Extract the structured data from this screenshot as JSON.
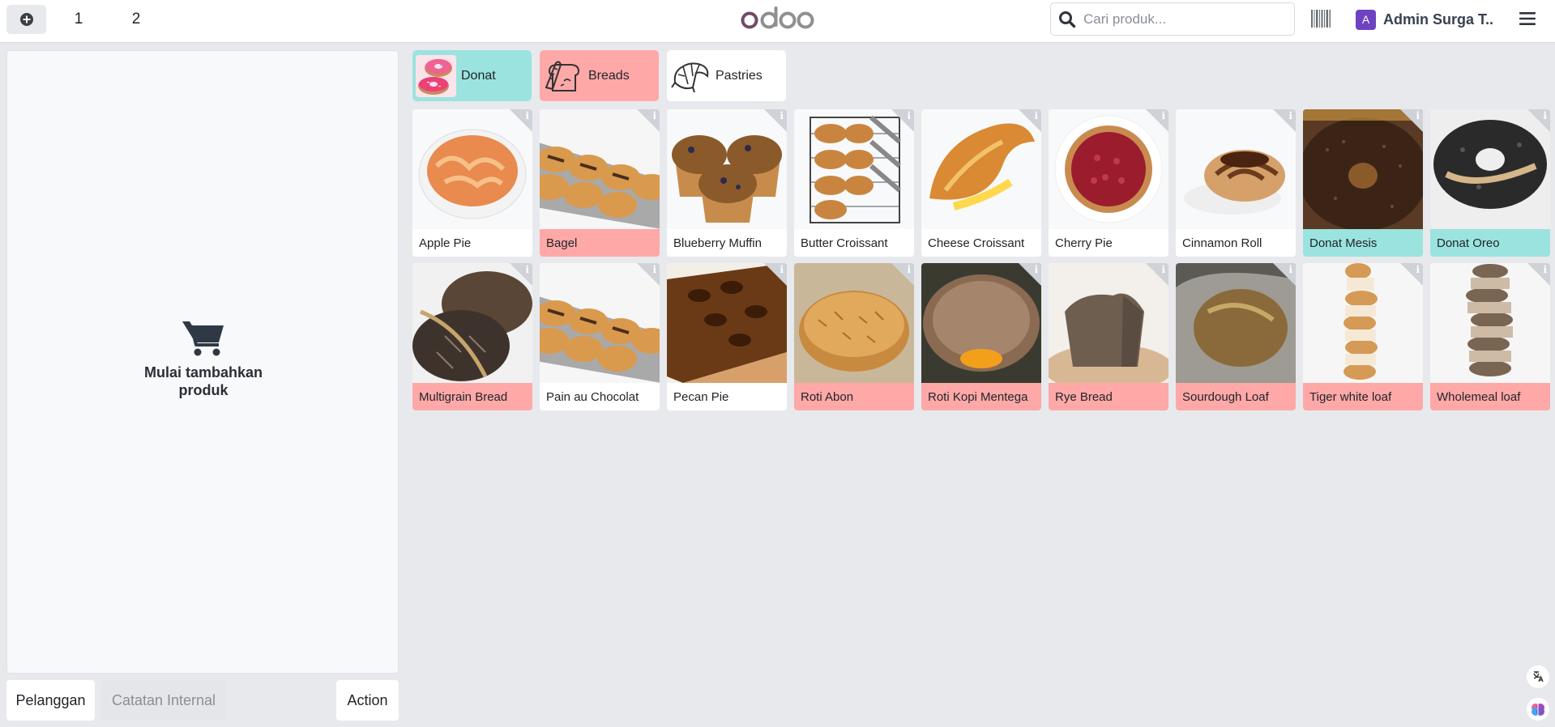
{
  "topbar": {
    "order_tabs": [
      "1",
      "2"
    ],
    "logo_text": "odoo",
    "search_placeholder": "Cari produk...",
    "user_initial": "A",
    "user_name": "Admin Surga T..."
  },
  "order": {
    "empty_message": "Mulai tambahkan produk"
  },
  "actions": {
    "customer": "Pelanggan",
    "internal_note": "Catatan Internal",
    "action": "Action"
  },
  "categories": [
    {
      "label": "Donat",
      "color": "#9be3de",
      "icon": "donut-icon"
    },
    {
      "label": "Breads",
      "color": "#ffa8a8",
      "icon": "bread-icon"
    },
    {
      "label": "Pastries",
      "color": "#ffffff",
      "icon": "croissant-icon"
    }
  ],
  "products": [
    {
      "name": "Apple Pie",
      "color": "#ffffff",
      "art": "pie"
    },
    {
      "name": "Bagel",
      "color": "#ffa8a8",
      "art": "tray"
    },
    {
      "name": "Blueberry Muffin",
      "color": "#ffffff",
      "art": "muffin"
    },
    {
      "name": "Butter Croissant",
      "color": "#ffffff",
      "art": "rack"
    },
    {
      "name": "Cheese Croissant",
      "color": "#ffffff",
      "art": "croissant"
    },
    {
      "name": "Cherry Pie",
      "color": "#ffffff",
      "art": "cherrypie"
    },
    {
      "name": "Cinnamon Roll",
      "color": "#ffffff",
      "art": "roll"
    },
    {
      "name": "Donat Mesis",
      "color": "#9be3de",
      "art": "donut-choc"
    },
    {
      "name": "Donat Oreo",
      "color": "#9be3de",
      "art": "donut-oreo"
    },
    {
      "name": "Multigrain Bread",
      "color": "#ffa8a8",
      "art": "multigrain"
    },
    {
      "name": "Pain au Chocolat",
      "color": "#ffffff",
      "art": "tray"
    },
    {
      "name": "Pecan Pie",
      "color": "#ffffff",
      "art": "pecan"
    },
    {
      "name": "Roti Abon",
      "color": "#ffa8a8",
      "art": "abon"
    },
    {
      "name": "Roti Kopi Mentega",
      "color": "#ffa8a8",
      "art": "kopi"
    },
    {
      "name": "Rye Bread",
      "color": "#ffa8a8",
      "art": "rye"
    },
    {
      "name": "Sourdough Loaf",
      "color": "#ffa8a8",
      "art": "sourdough"
    },
    {
      "name": "Tiger white loaf",
      "color": "#ffa8a8",
      "art": "tiger"
    },
    {
      "name": "Wholemeal loaf",
      "color": "#ffa8a8",
      "art": "wholemeal"
    }
  ]
}
